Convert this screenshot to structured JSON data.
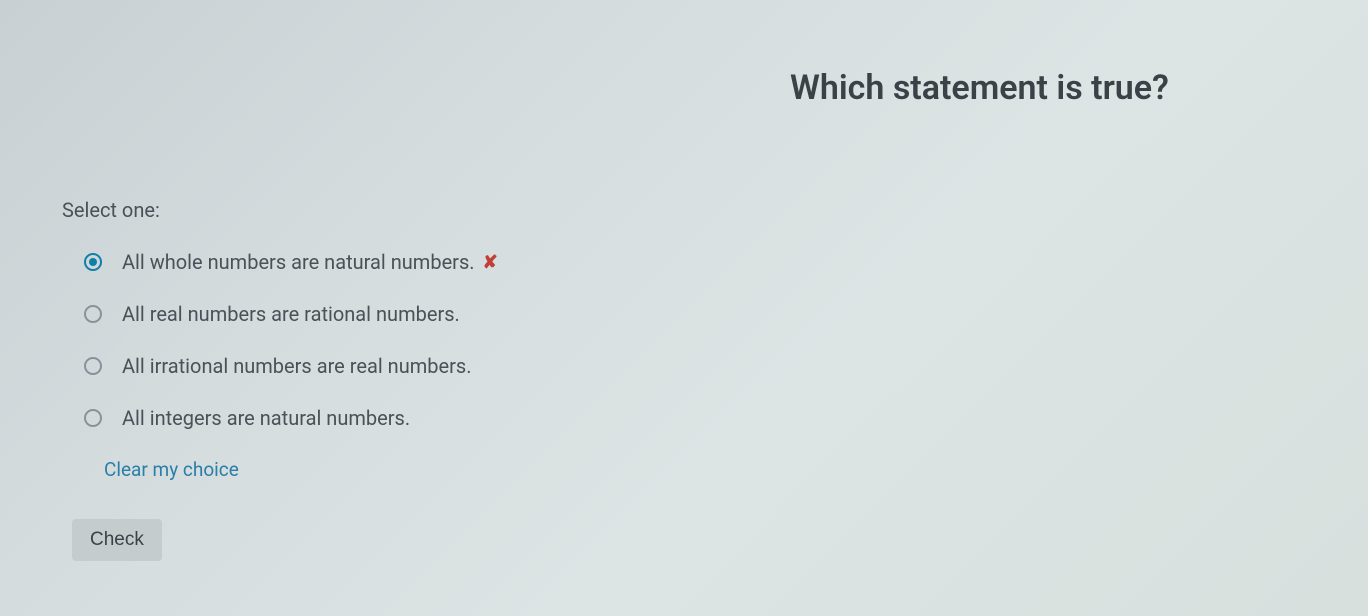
{
  "question": {
    "title": "Which statement is true?"
  },
  "answer": {
    "select_label": "Select one:",
    "options": [
      {
        "label": "All whole numbers are natural numbers.",
        "selected": true,
        "incorrect": true
      },
      {
        "label": "All real numbers are rational numbers.",
        "selected": false,
        "incorrect": false
      },
      {
        "label": "All irrational numbers are real numbers.",
        "selected": false,
        "incorrect": false
      },
      {
        "label": "All integers are natural numbers.",
        "selected": false,
        "incorrect": false
      }
    ],
    "clear_label": "Clear my choice",
    "check_label": "Check",
    "incorrect_symbol": "✘"
  }
}
